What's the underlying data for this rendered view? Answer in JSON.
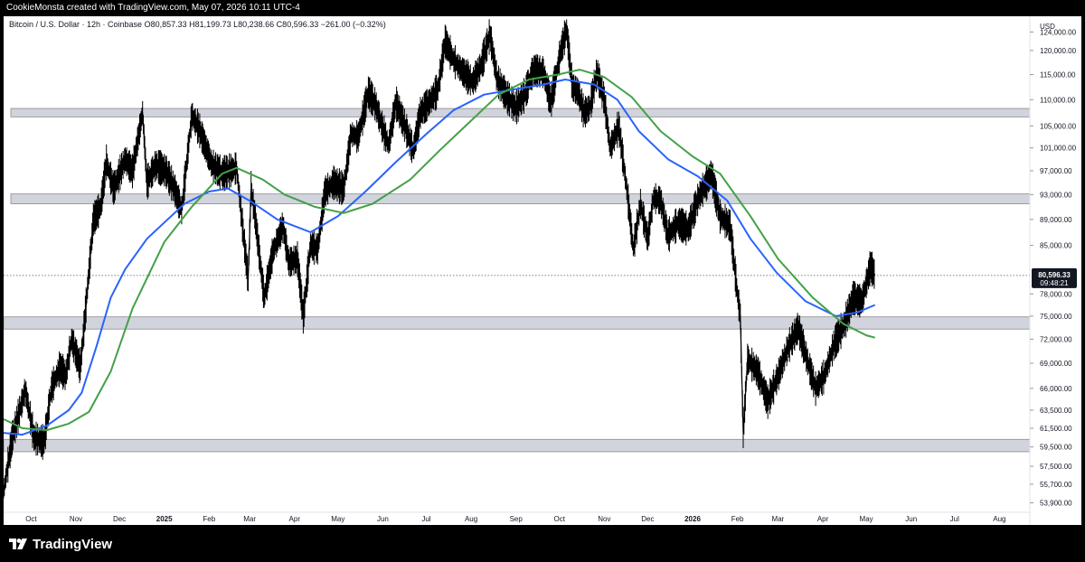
{
  "header": {
    "caption": "CookieMonsta created with TradingView.com, May 07, 2026 10:11 UTC-4"
  },
  "footer": {
    "brand": "TradingView",
    "logo_icon": "tradingview-logo-icon"
  },
  "colors": {
    "background": "#ffffff",
    "frame": "#000000",
    "candles": "#000000",
    "ma_blue": "#2962ff",
    "ma_green": "#43a047",
    "zones": "#d1d4dc",
    "zone_border": "#8a8a8a"
  },
  "chart_data": {
    "type": "line",
    "symbol_line": "Bitcoin / U.S. Dollar · 12h · Coinbase  O80,857.33  H81,199.73  L80,238.66  C80,596.33  −261.00 (−0.32%)",
    "currency": "USD",
    "last_price_label": "80,596.33",
    "countdown_label": "09:48:21",
    "last_price": 80596.33,
    "y_scale": "log",
    "ylim": [
      53000,
      127500
    ],
    "xlim": [
      "2024-09-12",
      "2026-08-22"
    ],
    "y_ticks": [
      "124,000.00",
      "120,000.00",
      "115,000.00",
      "110,000.00",
      "105,000.00",
      "101,000.00",
      "97,000.00",
      "93,000.00",
      "89,000.00",
      "85,000.00",
      "78,000.00",
      "75,000.00",
      "72,000.00",
      "69,000.00",
      "66,000.00",
      "63,500.00",
      "61,500.00",
      "59,500.00",
      "57,500.00",
      "55,700.00",
      "53,900.00"
    ],
    "x_ticks": [
      {
        "label": "Oct",
        "date": "2024-10-01"
      },
      {
        "label": "Nov",
        "date": "2024-11-01"
      },
      {
        "label": "Dec",
        "date": "2024-12-01"
      },
      {
        "label": "2025",
        "date": "2025-01-01"
      },
      {
        "label": "Feb",
        "date": "2025-02-01"
      },
      {
        "label": "Mar",
        "date": "2025-03-01"
      },
      {
        "label": "Apr",
        "date": "2025-04-01"
      },
      {
        "label": "May",
        "date": "2025-05-01"
      },
      {
        "label": "Jun",
        "date": "2025-06-01"
      },
      {
        "label": "Jul",
        "date": "2025-07-01"
      },
      {
        "label": "Aug",
        "date": "2025-08-01"
      },
      {
        "label": "Sep",
        "date": "2025-09-01"
      },
      {
        "label": "Oct",
        "date": "2025-10-01"
      },
      {
        "label": "Nov",
        "date": "2025-11-01"
      },
      {
        "label": "Dec",
        "date": "2025-12-01"
      },
      {
        "label": "2026",
        "date": "2026-01-01"
      },
      {
        "label": "Feb",
        "date": "2026-02-01"
      },
      {
        "label": "Mar",
        "date": "2026-03-01"
      },
      {
        "label": "Apr",
        "date": "2026-04-01"
      },
      {
        "label": "May",
        "date": "2026-05-01"
      },
      {
        "label": "Jun",
        "date": "2026-06-01"
      },
      {
        "label": "Jul",
        "date": "2026-07-01"
      },
      {
        "label": "Aug",
        "date": "2026-08-01"
      }
    ],
    "zones": [
      {
        "from": "2024-09-17",
        "to": "2026-08-22",
        "low": 106700,
        "high": 108300
      },
      {
        "from": "2024-09-17",
        "to": "2026-08-22",
        "low": 91500,
        "high": 93100
      },
      {
        "from": "2024-09-12",
        "to": "2026-08-22",
        "low": 73300,
        "high": 74900
      },
      {
        "from": "2024-09-12",
        "to": "2026-08-22",
        "low": 59000,
        "high": 60300
      }
    ],
    "price": {
      "name": "Bitcoin / U.S. Dollar · 12h",
      "points": [
        [
          "2024-09-12",
          55000
        ],
        [
          "2024-09-18",
          60500
        ],
        [
          "2024-09-27",
          65800
        ],
        [
          "2024-10-03",
          60500
        ],
        [
          "2024-10-10",
          60000
        ],
        [
          "2024-10-15",
          66000
        ],
        [
          "2024-10-21",
          68500
        ],
        [
          "2024-10-25",
          67500
        ],
        [
          "2024-10-29",
          72000
        ],
        [
          "2024-11-04",
          68500
        ],
        [
          "2024-11-08",
          76500
        ],
        [
          "2024-11-13",
          89000
        ],
        [
          "2024-11-18",
          91000
        ],
        [
          "2024-11-22",
          98500
        ],
        [
          "2024-11-27",
          94000
        ],
        [
          "2024-12-05",
          99000
        ],
        [
          "2024-12-10",
          97000
        ],
        [
          "2024-12-17",
          107500
        ],
        [
          "2024-12-20",
          95000
        ],
        [
          "2024-12-26",
          98000
        ],
        [
          "2025-01-02",
          97000
        ],
        [
          "2025-01-08",
          94000
        ],
        [
          "2025-01-13",
          90500
        ],
        [
          "2025-01-20",
          107000
        ],
        [
          "2025-01-25",
          104500
        ],
        [
          "2025-02-03",
          98000
        ],
        [
          "2025-02-10",
          96500
        ],
        [
          "2025-02-20",
          97500
        ],
        [
          "2025-02-25",
          86000
        ],
        [
          "2025-02-28",
          80000
        ],
        [
          "2025-03-02",
          94000
        ],
        [
          "2025-03-05",
          89000
        ],
        [
          "2025-03-11",
          77500
        ],
        [
          "2025-03-17",
          84000
        ],
        [
          "2025-03-24",
          88000
        ],
        [
          "2025-03-28",
          82500
        ],
        [
          "2025-04-03",
          83000
        ],
        [
          "2025-04-07",
          75000
        ],
        [
          "2025-04-12",
          85000
        ],
        [
          "2025-04-17",
          84500
        ],
        [
          "2025-04-22",
          93500
        ],
        [
          "2025-04-28",
          95000
        ],
        [
          "2025-05-05",
          94000
        ],
        [
          "2025-05-10",
          103500
        ],
        [
          "2025-05-15",
          103000
        ],
        [
          "2025-05-22",
          111500
        ],
        [
          "2025-05-27",
          109000
        ],
        [
          "2025-06-01",
          104500
        ],
        [
          "2025-06-05",
          101500
        ],
        [
          "2025-06-10",
          109500
        ],
        [
          "2025-06-17",
          104500
        ],
        [
          "2025-06-22",
          100500
        ],
        [
          "2025-06-27",
          107500
        ],
        [
          "2025-07-03",
          109500
        ],
        [
          "2025-07-09",
          112000
        ],
        [
          "2025-07-14",
          122000
        ],
        [
          "2025-07-20",
          118000
        ],
        [
          "2025-07-25",
          116000
        ],
        [
          "2025-08-02",
          113500
        ],
        [
          "2025-08-08",
          117000
        ],
        [
          "2025-08-14",
          123500
        ],
        [
          "2025-08-19",
          114000
        ],
        [
          "2025-08-26",
          110500
        ],
        [
          "2025-09-01",
          108500
        ],
        [
          "2025-09-07",
          111000
        ],
        [
          "2025-09-13",
          116000
        ],
        [
          "2025-09-20",
          115500
        ],
        [
          "2025-09-25",
          109500
        ],
        [
          "2025-10-02",
          120000
        ],
        [
          "2025-10-06",
          124500
        ],
        [
          "2025-10-10",
          112500
        ],
        [
          "2025-10-14",
          111500
        ],
        [
          "2025-10-18",
          107500
        ],
        [
          "2025-10-22",
          108500
        ],
        [
          "2025-10-27",
          115500
        ],
        [
          "2025-11-01",
          110000
        ],
        [
          "2025-11-05",
          101000
        ],
        [
          "2025-11-11",
          105000
        ],
        [
          "2025-11-17",
          93000
        ],
        [
          "2025-11-21",
          84500
        ],
        [
          "2025-11-26",
          91500
        ],
        [
          "2025-12-01",
          86000
        ],
        [
          "2025-12-05",
          92500
        ],
        [
          "2025-12-10",
          92000
        ],
        [
          "2025-12-15",
          86500
        ],
        [
          "2025-12-22",
          88500
        ],
        [
          "2025-12-29",
          87500
        ],
        [
          "2026-01-05",
          92500
        ],
        [
          "2026-01-14",
          96500
        ],
        [
          "2026-01-20",
          89500
        ],
        [
          "2026-01-27",
          88000
        ],
        [
          "2026-02-01",
          78000
        ],
        [
          "2026-02-03",
          75000
        ],
        [
          "2026-02-05",
          61000
        ],
        [
          "2026-02-08",
          69500
        ],
        [
          "2026-02-15",
          68000
        ],
        [
          "2026-02-22",
          64500
        ],
        [
          "2026-03-01",
          67500
        ],
        [
          "2026-03-08",
          71000
        ],
        [
          "2026-03-15",
          73500
        ],
        [
          "2026-03-21",
          69500
        ],
        [
          "2026-03-27",
          66000
        ],
        [
          "2026-04-02",
          67500
        ],
        [
          "2026-04-09",
          71500
        ],
        [
          "2026-04-16",
          74000
        ],
        [
          "2026-04-22",
          77500
        ],
        [
          "2026-04-28",
          77000
        ],
        [
          "2026-05-04",
          82000
        ],
        [
          "2026-05-07",
          80596
        ]
      ]
    },
    "series": [
      {
        "name": "",
        "color": "#2962ff",
        "points": [
          [
            "2024-09-12",
            61000
          ],
          [
            "2024-09-25",
            60800
          ],
          [
            "2024-10-12",
            61800
          ],
          [
            "2024-10-27",
            63500
          ],
          [
            "2024-11-05",
            65500
          ],
          [
            "2024-11-15",
            71000
          ],
          [
            "2024-11-25",
            77500
          ],
          [
            "2024-12-05",
            81500
          ],
          [
            "2024-12-20",
            86000
          ],
          [
            "2025-01-01",
            88500
          ],
          [
            "2025-01-15",
            91500
          ],
          [
            "2025-02-01",
            93500
          ],
          [
            "2025-02-14",
            94000
          ],
          [
            "2025-03-01",
            92000
          ],
          [
            "2025-03-20",
            89000
          ],
          [
            "2025-04-12",
            87000
          ],
          [
            "2025-05-01",
            89500
          ],
          [
            "2025-05-20",
            93500
          ],
          [
            "2025-06-10",
            98500
          ],
          [
            "2025-07-01",
            103500
          ],
          [
            "2025-07-20",
            108000
          ],
          [
            "2025-08-10",
            111000
          ],
          [
            "2025-08-30",
            112000
          ],
          [
            "2025-09-20",
            113000
          ],
          [
            "2025-10-05",
            114000
          ],
          [
            "2025-10-25",
            113000
          ],
          [
            "2025-11-10",
            110000
          ],
          [
            "2025-11-25",
            104000
          ],
          [
            "2025-12-15",
            99000
          ],
          [
            "2026-01-05",
            96000
          ],
          [
            "2026-01-25",
            92000
          ],
          [
            "2026-02-10",
            86000
          ],
          [
            "2026-02-28",
            81000
          ],
          [
            "2026-03-20",
            77000
          ],
          [
            "2026-04-10",
            75000
          ],
          [
            "2026-04-25",
            75500
          ],
          [
            "2026-05-07",
            76500
          ]
        ]
      },
      {
        "name": "",
        "color": "#43a047",
        "points": [
          [
            "2024-09-12",
            62500
          ],
          [
            "2024-09-25",
            61500
          ],
          [
            "2024-10-12",
            61300
          ],
          [
            "2024-10-27",
            62000
          ],
          [
            "2024-11-10",
            63300
          ],
          [
            "2024-11-25",
            68000
          ],
          [
            "2024-12-10",
            76000
          ],
          [
            "2025-01-01",
            85500
          ],
          [
            "2025-01-20",
            91000
          ],
          [
            "2025-02-10",
            96500
          ],
          [
            "2025-02-20",
            97500
          ],
          [
            "2025-03-10",
            95500
          ],
          [
            "2025-03-25",
            93000
          ],
          [
            "2025-04-15",
            91000
          ],
          [
            "2025-05-05",
            90000
          ],
          [
            "2025-05-25",
            91500
          ],
          [
            "2025-06-20",
            95500
          ],
          [
            "2025-07-10",
            100500
          ],
          [
            "2025-07-30",
            105500
          ],
          [
            "2025-08-20",
            111000
          ],
          [
            "2025-09-10",
            114000
          ],
          [
            "2025-09-30",
            115000
          ],
          [
            "2025-10-15",
            116000
          ],
          [
            "2025-11-01",
            114500
          ],
          [
            "2025-11-20",
            110500
          ],
          [
            "2025-12-10",
            104000
          ],
          [
            "2026-01-01",
            99500
          ],
          [
            "2026-01-20",
            96500
          ],
          [
            "2026-02-10",
            89500
          ],
          [
            "2026-03-01",
            83000
          ],
          [
            "2026-03-25",
            77500
          ],
          [
            "2026-04-15",
            74000
          ],
          [
            "2026-05-01",
            72500
          ],
          [
            "2026-05-07",
            72200
          ]
        ]
      }
    ]
  }
}
